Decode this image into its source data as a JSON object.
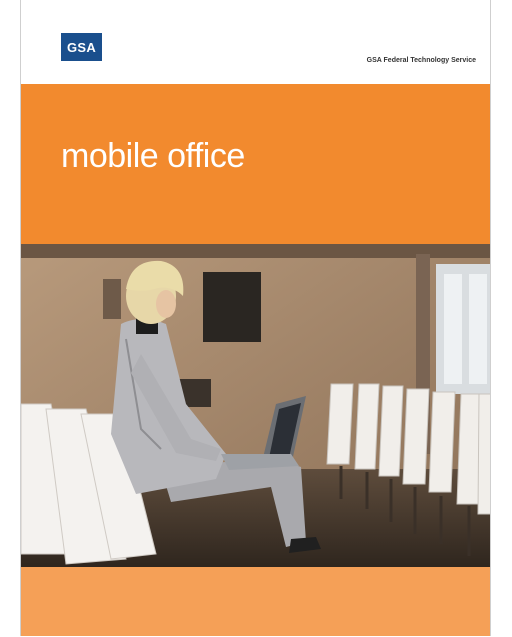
{
  "header": {
    "logo_text": "GSA",
    "service_name": "GSA Federal Technology Service"
  },
  "banner": {
    "title": "mobile office"
  },
  "colors": {
    "brand_blue": "#1a4f8d",
    "orange": "#f28a2e",
    "light_orange": "#f5a057"
  },
  "photo": {
    "icon": "woman-with-laptop-photo"
  }
}
